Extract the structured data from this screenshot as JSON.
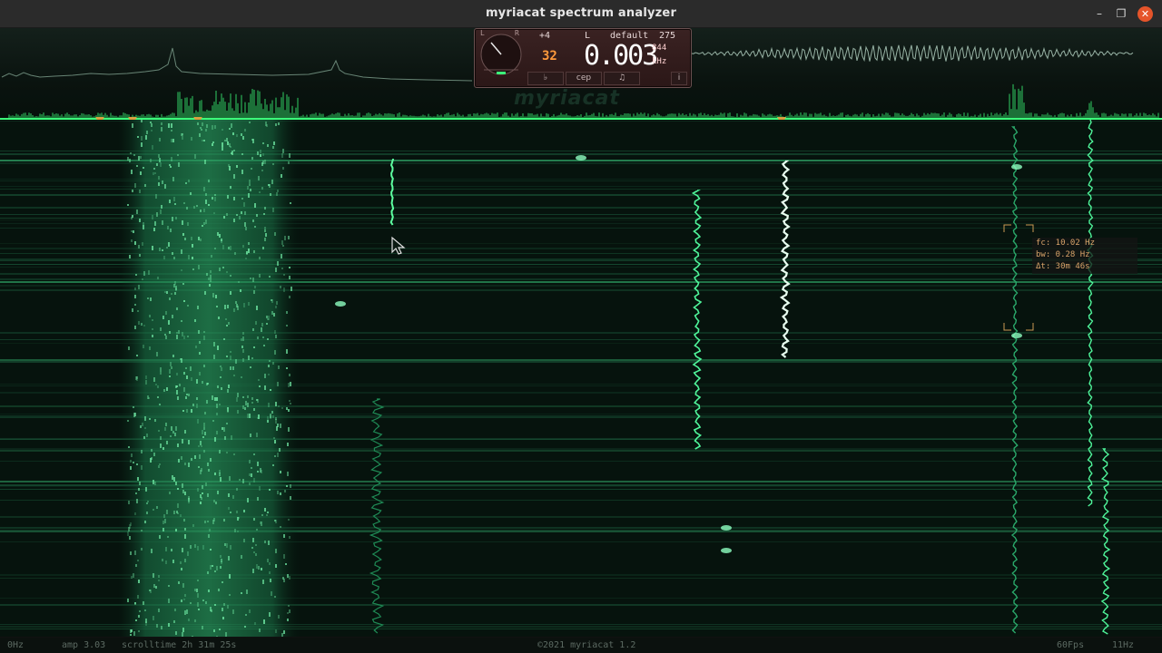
{
  "window": {
    "title": "myriacat spectrum analyzer",
    "minimize_label": "–",
    "maximize_label": "❐",
    "close_label": "✕"
  },
  "panel": {
    "dial_left_label": "L",
    "dial_right_label": "R",
    "gain": "+4",
    "channel": "L",
    "preset": "default",
    "count": "275",
    "orange_value": "32",
    "frequency": "0.003",
    "fine_digits": "844",
    "unit": "kHz",
    "buttons": {
      "tuning": "♭",
      "cep": "cep",
      "note": "♫",
      "info": "i"
    }
  },
  "watermark": "myriacat",
  "tooltip": {
    "fc": "fc: 10.02 Hz",
    "bw": "bw: 0.28 Hz",
    "dt": "Δt: 30m 46s"
  },
  "status": {
    "left_freq": "0Hz",
    "amp": "amp 3.03",
    "scrolltime": "scrolltime 2h 31m 25s",
    "copyright": "©2021 myriacat 1.2",
    "fps": "60Fps",
    "right_freq": "11Hz"
  },
  "colors": {
    "trace": "#3cff7a",
    "waterfall_bg": "#06130d",
    "marker": "#d9a040",
    "tooltip_text": "#d9a36a"
  }
}
